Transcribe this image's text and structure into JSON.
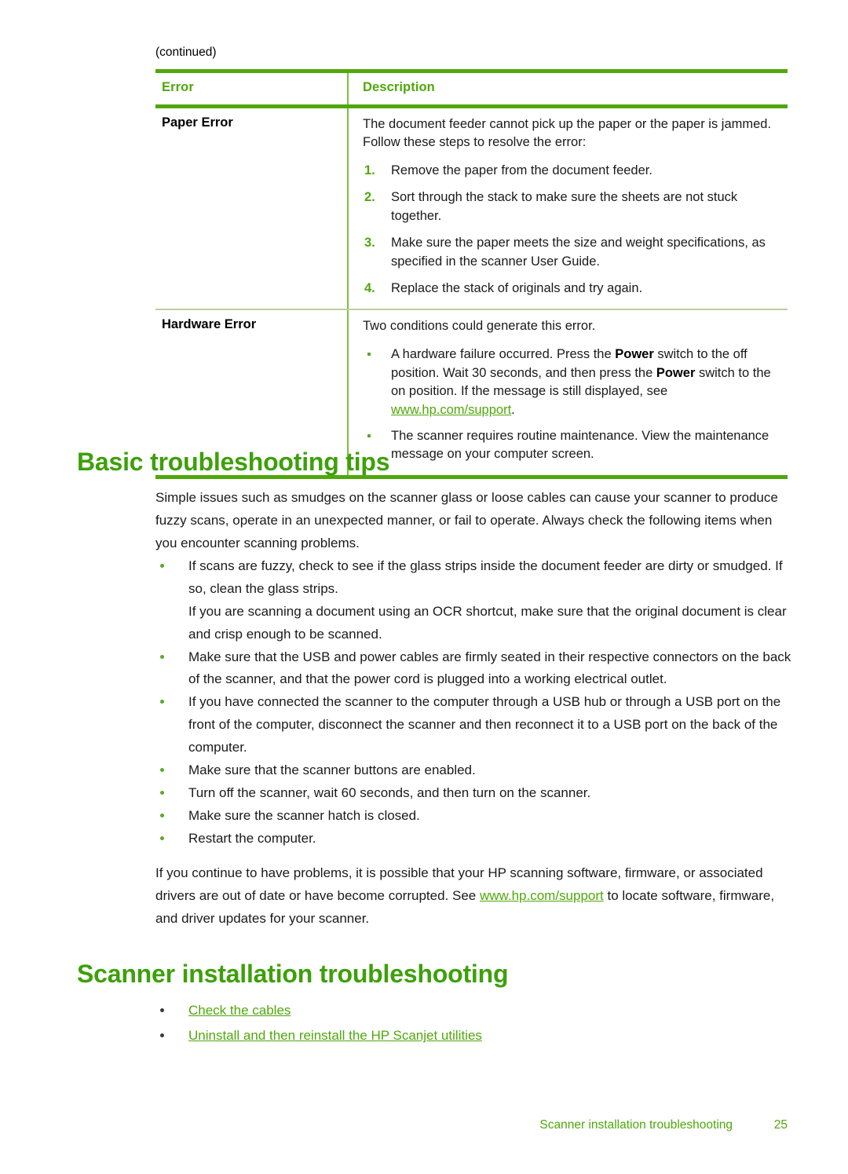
{
  "page": {
    "continued_label": "(continued)",
    "footer": {
      "section": "Scanner installation troubleshooting",
      "page_number": "25"
    },
    "colors": {
      "heading_green": "#3da00a",
      "rule_green": "#4fa80a",
      "divider_green": "#7bbf3f",
      "link_green": "#4fa80a",
      "body_text": "#1a1a1a"
    }
  },
  "table": {
    "headers": {
      "error": "Error",
      "description": "Description"
    },
    "rows": [
      {
        "error": "Paper Error",
        "intro": "The document feeder cannot pick up the paper or the paper is jammed. Follow these steps to resolve the error:",
        "steps": [
          {
            "num": "1.",
            "text": "Remove the paper from the document feeder."
          },
          {
            "num": "2.",
            "text": "Sort through the stack to make sure the sheets are not stuck together."
          },
          {
            "num": "3.",
            "text": "Make sure the paper meets the size and weight specifications, as specified in the scanner User Guide."
          },
          {
            "num": "4.",
            "text": "Replace the stack of originals and try again."
          }
        ]
      },
      {
        "error": "Hardware Error",
        "intro": "Two conditions could generate this error.",
        "bullets": {
          "first": {
            "part1": "A hardware failure occurred. Press the ",
            "bold1": "Power",
            "part2": " switch to the off position. Wait 30 seconds, and then press the ",
            "bold2": "Power",
            "part3": " switch to the on position. If the message is still displayed, see ",
            "link": "www.hp.com/support",
            "part4": "."
          },
          "second": "The scanner requires routine maintenance. View the maintenance message on your computer screen."
        }
      }
    ]
  },
  "basic_troubleshooting": {
    "heading": "Basic troubleshooting tips",
    "intro": "Simple issues such as smudges on the scanner glass or loose cables can cause your scanner to produce fuzzy scans, operate in an unexpected manner, or fail to operate. Always check the following items when you encounter scanning problems.",
    "bullets": [
      {
        "text": "If scans are fuzzy, check to see if the glass strips inside the document feeder are dirty or smudged. If so, clean the glass strips.",
        "sub": "If you are scanning a document using an OCR shortcut, make sure that the original document is clear and crisp enough to be scanned."
      },
      {
        "text": "Make sure that the USB and power cables are firmly seated in their respective connectors on the back of the scanner, and that the power cord is plugged into a working electrical outlet."
      },
      {
        "text": "If you have connected the scanner to the computer through a USB hub or through a USB port on the front of the computer, disconnect the scanner and then reconnect it to a USB port on the back of the computer."
      },
      {
        "text": "Make sure that the scanner buttons are enabled."
      },
      {
        "text": "Turn off the scanner, wait 60 seconds, and then turn on the scanner."
      },
      {
        "text": "Make sure the scanner hatch is closed."
      },
      {
        "text": "Restart the computer."
      }
    ],
    "outro": {
      "part1": "If you continue to have problems, it is possible that your HP scanning software, firmware, or associated drivers are out of date or have become corrupted. See ",
      "link": "www.hp.com/support",
      "part2": " to locate software, firmware, and driver updates for your scanner."
    }
  },
  "installation_troubleshooting": {
    "heading": "Scanner installation troubleshooting",
    "links": [
      "Check the cables",
      "Uninstall and then reinstall the HP Scanjet utilities"
    ]
  }
}
